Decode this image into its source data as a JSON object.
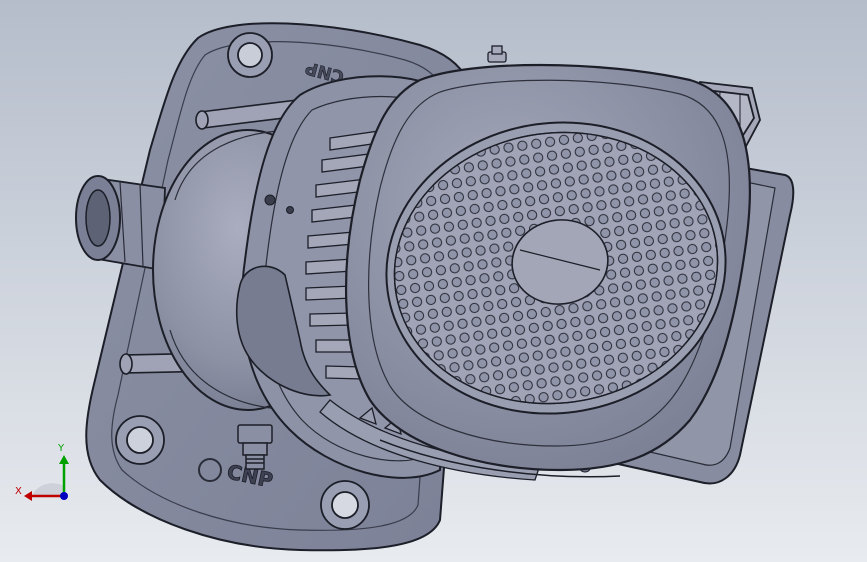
{
  "viewport": {
    "background_top": "#b9c1cf",
    "background_bottom": "#e7eaee",
    "part_color": "#8e93a6",
    "edge_color": "#1c1e28"
  },
  "model": {
    "brand_mark": "CNP",
    "mirrored_mark": "CNP"
  },
  "triad": {
    "x_label": "X",
    "y_label": "Y",
    "x_color": "#c00000",
    "y_color": "#00a000",
    "z_color": "#0000c0"
  }
}
